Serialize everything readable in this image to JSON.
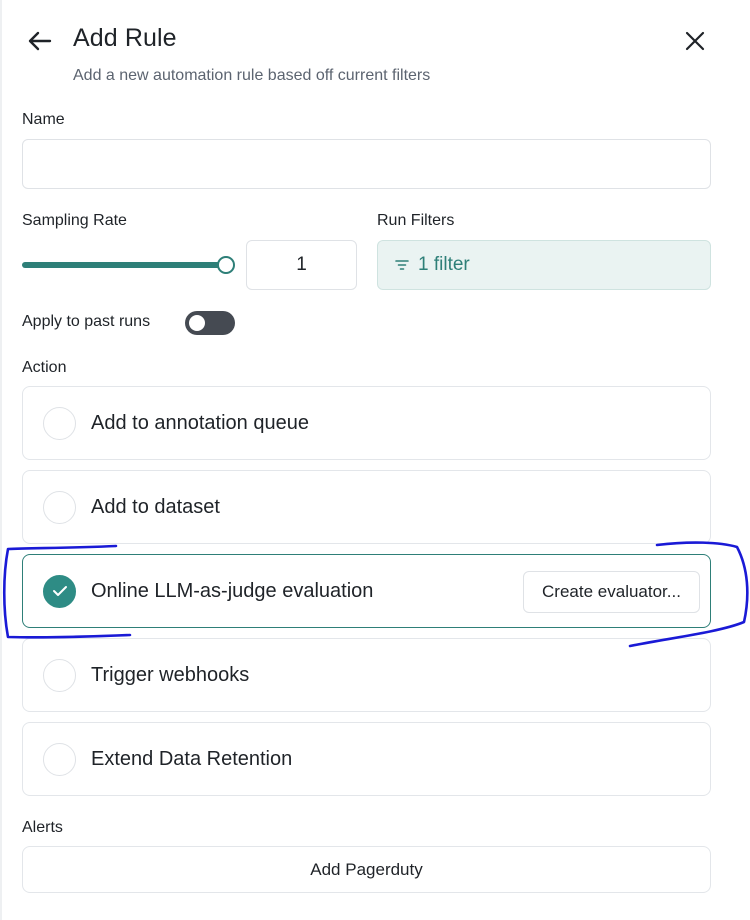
{
  "header": {
    "title": "Add Rule",
    "subtitle": "Add a new automation rule based off current filters"
  },
  "name_field": {
    "label": "Name",
    "value": "",
    "placeholder": ""
  },
  "sampling": {
    "label": "Sampling Rate",
    "value": "1",
    "slider_fraction": 1.0
  },
  "filters": {
    "label": "Run Filters",
    "button_label": "1 filter"
  },
  "apply_past": {
    "label": "Apply to past runs",
    "enabled": false
  },
  "action": {
    "label": "Action",
    "options": [
      {
        "label": "Add to annotation queue",
        "selected": false
      },
      {
        "label": "Add to dataset",
        "selected": false
      },
      {
        "label": "Online LLM-as-judge evaluation",
        "selected": true,
        "button_label": "Create evaluator..."
      },
      {
        "label": "Trigger webhooks",
        "selected": false
      },
      {
        "label": "Extend Data Retention",
        "selected": false
      }
    ]
  },
  "alerts": {
    "label": "Alerts",
    "button_label": "Add Pagerduty"
  },
  "colors": {
    "accent": "#2e7f78",
    "check_fill": "#2e8c85",
    "filter_bg": "#eaf3f2",
    "toggle_off": "#454a52",
    "annotation_ink": "#1a1ad6"
  },
  "icons": {
    "back": "arrow-left-icon",
    "close": "close-icon",
    "filter": "filter-lines-icon",
    "check": "check-icon"
  }
}
